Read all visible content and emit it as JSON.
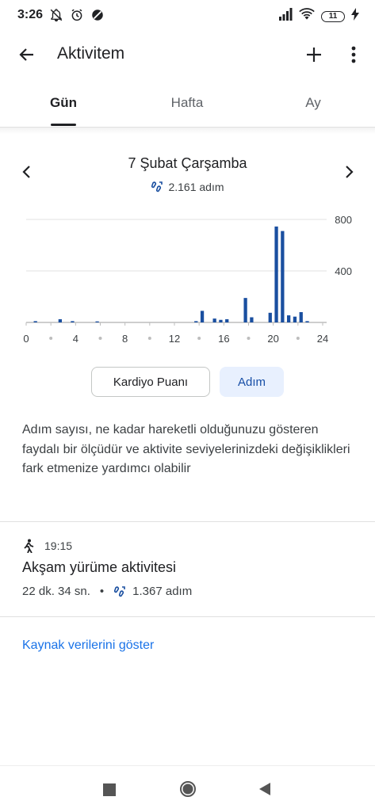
{
  "status_bar": {
    "time": "3:26",
    "battery": "11"
  },
  "app_bar": {
    "title": "Aktivitem"
  },
  "tabs": [
    {
      "label": "Gün"
    },
    {
      "label": "Hafta"
    },
    {
      "label": "Ay"
    }
  ],
  "date_header": {
    "title": "7 Şubat Çarşamba",
    "steps": "2.161 adım"
  },
  "chart_data": {
    "type": "bar",
    "x": [
      0,
      1,
      2,
      3,
      4,
      5,
      6,
      7,
      8,
      9,
      10,
      11,
      12,
      13,
      14,
      15,
      16,
      17,
      18,
      19,
      20,
      21,
      22,
      23,
      24,
      25,
      26,
      27,
      28,
      29,
      30,
      31,
      32,
      33,
      34,
      35,
      36,
      37,
      38,
      39,
      40,
      41,
      42,
      43,
      44,
      45,
      46,
      47
    ],
    "x_unit": "half-hour slot (hour = x/2)",
    "values": [
      0,
      10,
      0,
      0,
      0,
      25,
      0,
      10,
      0,
      0,
      0,
      8,
      0,
      0,
      0,
      0,
      0,
      0,
      0,
      0,
      0,
      0,
      0,
      0,
      0,
      0,
      0,
      10,
      90,
      0,
      30,
      20,
      25,
      0,
      0,
      190,
      40,
      0,
      0,
      75,
      745,
      710,
      55,
      45,
      80,
      10,
      0,
      0
    ],
    "xticks": [
      "0",
      "4",
      "8",
      "12",
      "16",
      "20",
      "24"
    ],
    "yticks": [
      "400",
      "800"
    ],
    "ylim": [
      0,
      800
    ],
    "color": "#1a4fa0"
  },
  "toggles": {
    "cardio_label": "Kardiyo Puanı",
    "steps_label": "Adım"
  },
  "description": "Adım sayısı, ne kadar hareketli olduğunuzu gösteren faydalı bir ölçüdür ve aktivite seviyelerinizdeki değişiklikleri fark etmenize yardımcı olabilir",
  "activity": {
    "time": "19:15",
    "title": "Akşam yürüme aktivitesi",
    "duration": "22 dk. 34 sn.",
    "separator": "•",
    "steps": "1.367 adım"
  },
  "link_label": "Kaynak verilerini göster",
  "colors": {
    "accent": "#1a73e8",
    "bar": "#1a4fa0",
    "toggle_bg": "#e8f0fe"
  }
}
